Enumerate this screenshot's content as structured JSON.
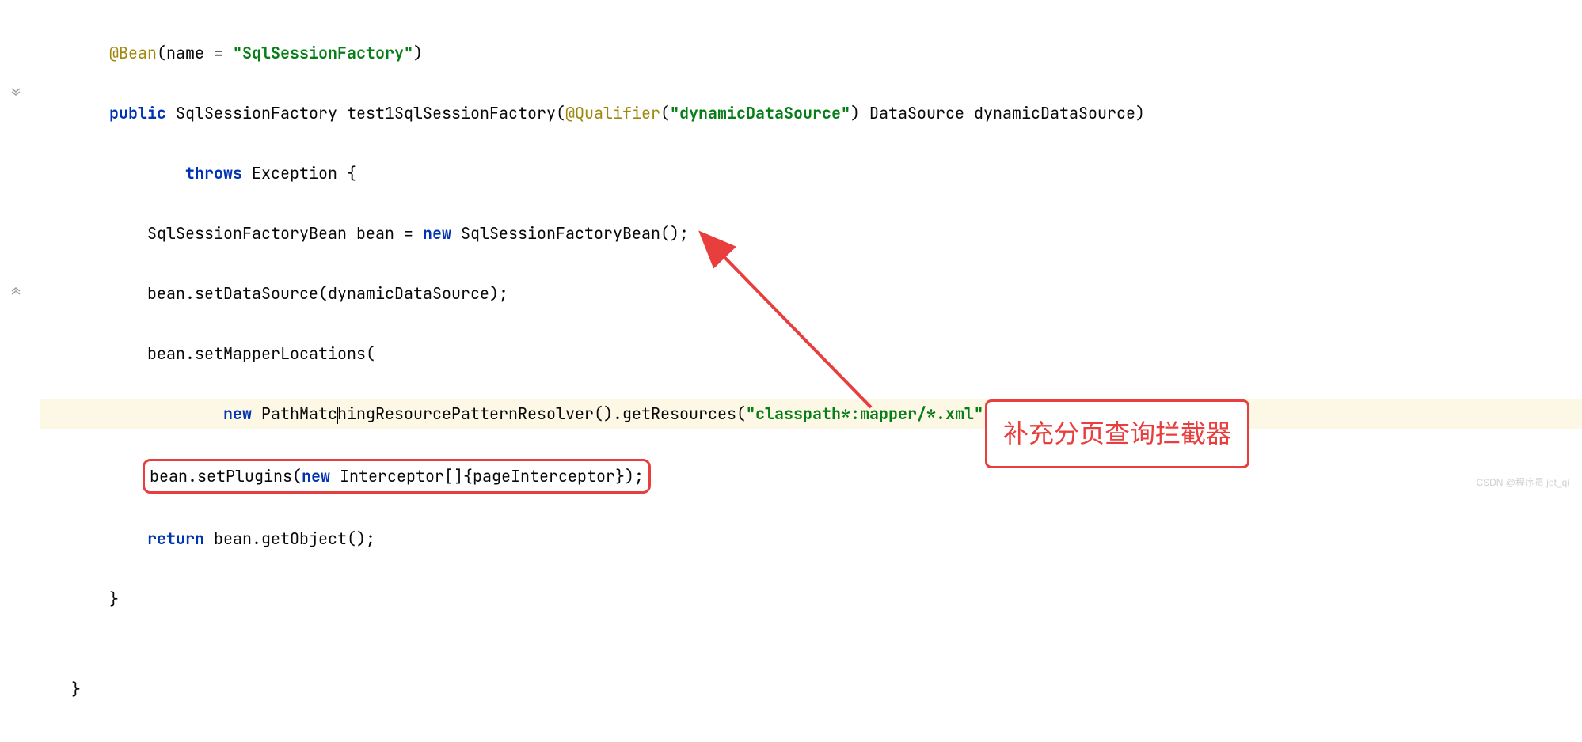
{
  "code": {
    "line1": {
      "indent": "    ",
      "annot": "@Bean",
      "text1": "(name = ",
      "str": "\"SqlSessionFactory\"",
      "text2": ")"
    },
    "line2": {
      "indent": "    ",
      "kw1": "public",
      "text1": " SqlSessionFactory test1SqlSessionFactory(",
      "annot": "@Qualifier",
      "text2": "(",
      "str": "\"dynamicDataSource\"",
      "text3": ") DataSource dynamicDataSource)"
    },
    "line3": {
      "indent": "            ",
      "kw": "throws",
      "text": " Exception {"
    },
    "line4": {
      "indent": "        ",
      "text1": "SqlSessionFactoryBean bean = ",
      "kw": "new",
      "text2": " SqlSessionFactoryBean();"
    },
    "line5": {
      "indent": "        ",
      "text": "bean.setDataSource(dynamicDataSource);"
    },
    "line6": {
      "indent": "        ",
      "text": "bean.setMapperLocations("
    },
    "line7": {
      "indent": "                ",
      "kw": "new",
      "text1": " PathMatc",
      "text1b": "hingResourcePatternResolver().getResources(",
      "str": "\"classpath*:mapper/*.xml\"",
      "text2": "));"
    },
    "line8": {
      "indent": "        ",
      "text1": "bean.setPlugins(",
      "kw": "new",
      "text2": " Interceptor[]{pageInterceptor});"
    },
    "line9": {
      "indent": "        ",
      "kw": "return",
      "text": " bean.getObject();"
    },
    "line10": {
      "indent": "    ",
      "text": "}"
    },
    "line11": {
      "indent": "",
      "text": ""
    },
    "line12": {
      "indent": "",
      "text": "}"
    }
  },
  "annotation_label": "补充分页查询拦截器",
  "watermark": "CSDN @程序员 jet_qi"
}
